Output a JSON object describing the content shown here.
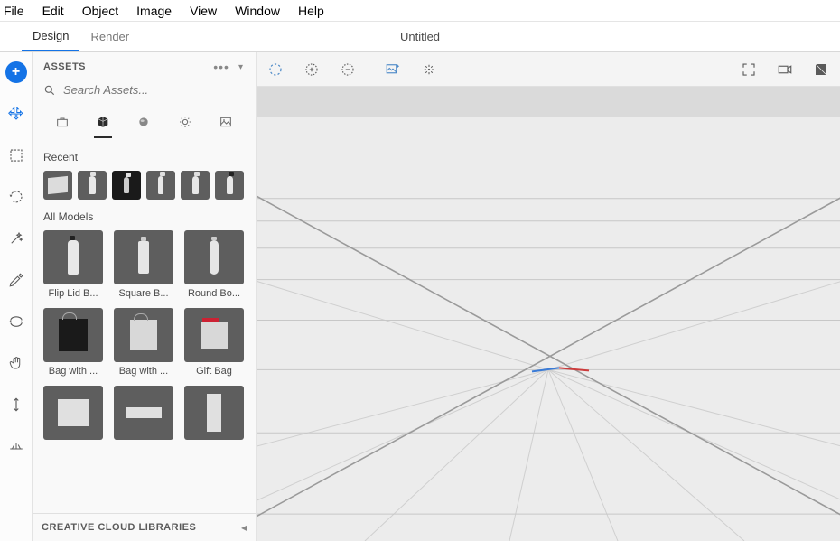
{
  "menubar": [
    "File",
    "Edit",
    "Object",
    "Image",
    "View",
    "Window",
    "Help"
  ],
  "modes": {
    "design": "Design",
    "render": "Render"
  },
  "document_title": "Untitled",
  "assets": {
    "panel_title": "ASSETS",
    "search_placeholder": "Search Assets...",
    "categories": [
      "starter",
      "models",
      "materials",
      "lights",
      "images"
    ],
    "recent_title": "Recent",
    "recent": [
      "box",
      "bottle",
      "bag-dark",
      "bottle2",
      "bottle3",
      "bottle4"
    ],
    "all_models_title": "All Models",
    "models": [
      {
        "label": "Flip Lid B...",
        "shape": "bottle"
      },
      {
        "label": "Square B...",
        "shape": "sq-bottle"
      },
      {
        "label": "Round Bo...",
        "shape": "round-bottle"
      },
      {
        "label": "Bag with ...",
        "shape": "bag-dark"
      },
      {
        "label": "Bag with ...",
        "shape": "bag-light"
      },
      {
        "label": "Gift Bag",
        "shape": "gift"
      },
      {
        "label": "",
        "shape": "cube"
      },
      {
        "label": "",
        "shape": "flat"
      },
      {
        "label": "",
        "shape": "tall"
      }
    ]
  },
  "cc_libraries_title": "CREATIVE CLOUD LIBRARIES"
}
